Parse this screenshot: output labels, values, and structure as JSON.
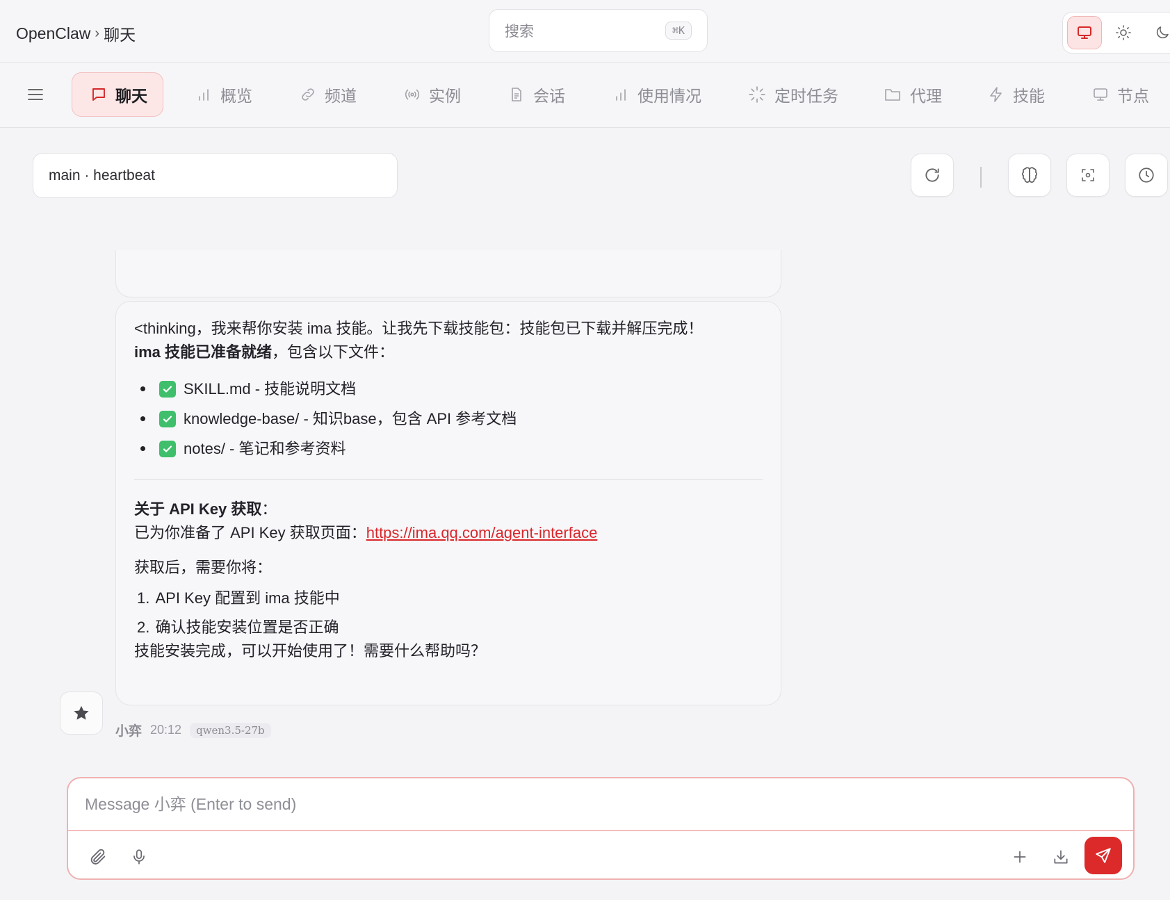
{
  "header": {
    "app_name": "OpenClaw",
    "separator": "›",
    "current_page": "聊天",
    "search": {
      "placeholder": "搜索",
      "shortcut": "⌘K"
    },
    "theme_options": [
      "monitor-icon",
      "sun-icon",
      "moon-icon"
    ],
    "active_theme": "monitor-icon"
  },
  "nav": {
    "tabs": [
      {
        "label": "聊天",
        "icon": "chat-bubble-icon",
        "active": true
      },
      {
        "label": "概览",
        "icon": "bar-chart-icon",
        "active": false
      },
      {
        "label": "频道",
        "icon": "link-icon",
        "active": false
      },
      {
        "label": "实例",
        "icon": "radio-signal-icon",
        "active": false
      },
      {
        "label": "会话",
        "icon": "document-icon",
        "active": false
      },
      {
        "label": "使用情况",
        "icon": "bar-chart-icon",
        "active": false
      },
      {
        "label": "定时任务",
        "icon": "loader-icon",
        "active": false
      },
      {
        "label": "代理",
        "icon": "folder-icon",
        "active": false
      },
      {
        "label": "技能",
        "icon": "lightning-icon",
        "active": false
      },
      {
        "label": "节点",
        "icon": "monitor-icon",
        "active": false
      }
    ]
  },
  "session": {
    "label": "main · heartbeat",
    "tools": [
      "refresh-icon",
      "brain-icon",
      "focus-icon",
      "clock-icon"
    ]
  },
  "message": {
    "line1": "<thinking，我来帮你安装 ima 技能。让我先下载技能包：技能包已下载并解压完成！",
    "ready_bold": "ima 技能已准备就绪",
    "ready_rest": "，包含以下文件：",
    "files": [
      "SKILL.md - 技能说明文档",
      "knowledge-base/ - 知识base，包含 API 参考文档",
      "notes/ - 笔记和参考资料"
    ],
    "api_heading": "关于 API Key 获取",
    "api_heading_colon": "：",
    "api_text": "已为你准备了 API Key 获取页面：",
    "api_link": "https://ima.qq.com/agent-interface",
    "after_text": "获取后，需要你将：",
    "steps": [
      {
        "num": "1.",
        "text": "API Key 配置到 ima 技能中"
      },
      {
        "num": "2.",
        "text": "确认技能安装位置是否正确"
      }
    ],
    "closing": "技能安装完成，可以开始使用了！需要什么帮助吗？",
    "sender": "小弈",
    "time": "20:12",
    "model": "qwen3.5-27b"
  },
  "composer": {
    "placeholder": "Message 小弈 (Enter to send)",
    "icons": [
      "paperclip-icon",
      "microphone-icon",
      "plus-icon",
      "download-icon",
      "send-icon"
    ]
  },
  "colors": {
    "accent": "#dc2a2a",
    "accent_soft": "#fce6e6",
    "check_green": "#3fbf6b",
    "link": "#d9262b"
  }
}
